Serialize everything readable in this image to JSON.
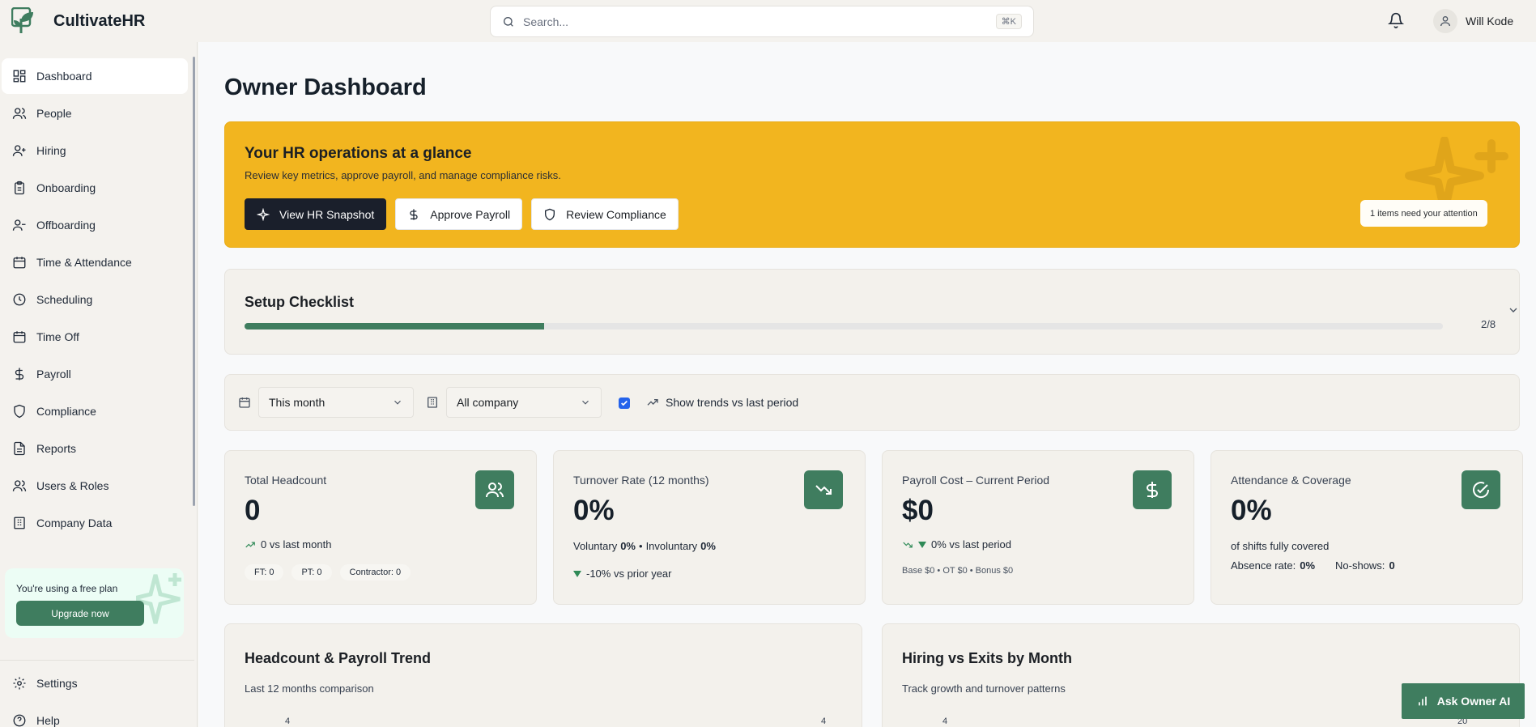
{
  "app": {
    "name": "CultivateHR"
  },
  "search": {
    "placeholder": "Search...",
    "shortcut": "⌘K"
  },
  "user": {
    "name": "Will Kode"
  },
  "sidebar": {
    "items": [
      {
        "label": "Dashboard",
        "icon": "grid-icon",
        "active": true
      },
      {
        "label": "People",
        "icon": "users-icon"
      },
      {
        "label": "Hiring",
        "icon": "user-plus-icon"
      },
      {
        "label": "Onboarding",
        "icon": "clipboard-icon"
      },
      {
        "label": "Offboarding",
        "icon": "user-minus-icon"
      },
      {
        "label": "Time & Attendance",
        "icon": "calendar-icon"
      },
      {
        "label": "Scheduling",
        "icon": "clock-icon"
      },
      {
        "label": "Time Off",
        "icon": "calendar-icon"
      },
      {
        "label": "Payroll",
        "icon": "dollar-icon"
      },
      {
        "label": "Compliance",
        "icon": "shield-icon"
      },
      {
        "label": "Reports",
        "icon": "file-text-icon"
      },
      {
        "label": "Users & Roles",
        "icon": "users-icon"
      },
      {
        "label": "Company Data",
        "icon": "building-icon"
      }
    ],
    "plan": {
      "text": "You're using a free plan",
      "button": "Upgrade now"
    },
    "bottom": [
      {
        "label": "Settings",
        "icon": "gear-icon"
      },
      {
        "label": "Help",
        "icon": "help-circle-icon"
      }
    ]
  },
  "page": {
    "title": "Owner Dashboard"
  },
  "hero": {
    "title": "Your HR operations at a glance",
    "subtitle": "Review key metrics, approve payroll, and manage compliance risks.",
    "buttons": {
      "snapshot": "View HR Snapshot",
      "payroll": "Approve Payroll",
      "compliance": "Review Compliance"
    },
    "attention": "1 items need your attention"
  },
  "setup": {
    "title": "Setup Checklist",
    "done": 2,
    "total": 8,
    "progress_text": "2/8"
  },
  "filters": {
    "period": "This month",
    "scope": "All company",
    "trends_label": "Show trends vs last period",
    "trends_checked": true
  },
  "kpis": {
    "headcount": {
      "label": "Total Headcount",
      "value": "0",
      "trend": "0 vs last month",
      "ft": "FT: 0",
      "pt": "PT: 0",
      "contractor": "Contractor: 0"
    },
    "turnover": {
      "label": "Turnover Rate (12 months)",
      "value": "0%",
      "voluntary_label": "Voluntary",
      "voluntary": "0%",
      "sep": "•",
      "involuntary_label": "Involuntary",
      "involuntary": "0%",
      "yoy": "-10% vs prior year"
    },
    "payroll": {
      "label": "Payroll Cost – Current Period",
      "value": "$0",
      "trend": "0% vs last period",
      "breakdown": "Base $0 • OT $0 • Bonus $0"
    },
    "attendance": {
      "label": "Attendance & Coverage",
      "value": "0%",
      "sub": "of shifts fully covered",
      "absence_label": "Absence rate:",
      "absence": "0%",
      "noshow_label": "No-shows:",
      "noshow": "0"
    }
  },
  "charts": {
    "left": {
      "title": "Headcount & Payroll Trend",
      "subtitle": "Last 12 months comparison",
      "tick_left": "4",
      "tick_right": "4"
    },
    "right": {
      "title": "Hiring vs Exits by Month",
      "subtitle": "Track growth and turnover patterns",
      "tick_left": "4",
      "tick_right": "20"
    }
  },
  "assistant": {
    "label": "Ask Owner AI"
  },
  "colors": {
    "brand": "#3f7d5f",
    "hero": "#f2b51f",
    "dark": "#1a1f2b",
    "positive": "#2f8a57"
  }
}
